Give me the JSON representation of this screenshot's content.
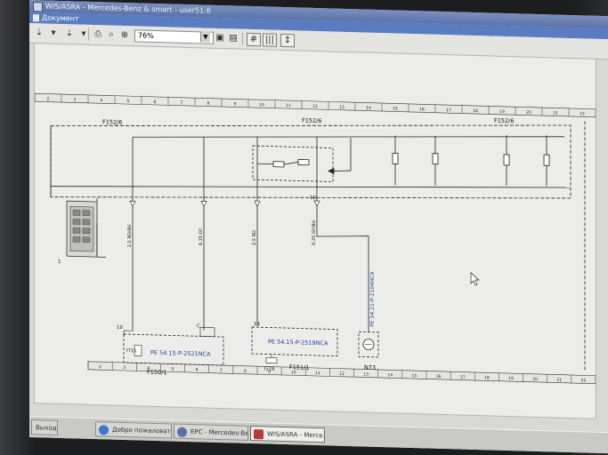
{
  "window": {
    "title": "WIS/ASRA - Mercedes-Benz & smart - user51:6",
    "menu_label": "Документ"
  },
  "toolbar": {
    "zoom_value": "76%",
    "icons": [
      "arrow-down-icon",
      "arrow-down-icon",
      "arrow-down-icon",
      "print-icon",
      "zoom-in-icon",
      "zoom-fit-icon",
      "camera-icon",
      "image-icon",
      "grid-icon",
      "columns-icon",
      "navigate-icon"
    ]
  },
  "diagram": {
    "ruler_numbers": [
      "2",
      "3",
      "4",
      "5",
      "6",
      "7",
      "8",
      "9",
      "10",
      "11",
      "12",
      "13",
      "14",
      "15",
      "16",
      "17",
      "18",
      "19",
      "20",
      "21",
      "22"
    ],
    "labels": {
      "f152_left": "F152/6",
      "f152_mid": "F152/6",
      "f152_right": "F152/6",
      "wire1": "2.5 RD/BU",
      "wire2": "0.35 GY",
      "wire3": "2.5 RD",
      "wire4": "0.35 GY/BU",
      "wire5": "PE 54.21-P-2104NCA",
      "ref1": "PE 54.15-P-2521NCA",
      "ref2": "PE 54.15-P-2519NCA",
      "f150": "F150/1",
      "f151": "F151/1",
      "g19": "G19",
      "f715": "f715",
      "n73": "N73",
      "pin10a": "10",
      "pin_c": "C",
      "pin13": "13",
      "pin10b": "10",
      "pin1": "1"
    }
  },
  "taskbar": {
    "exit": "Выход",
    "items": [
      {
        "label": "Добро пожаловать - ...",
        "color": "#3a78c8"
      },
      {
        "label": "EPC - Mercedes-Benz ...",
        "color": "#5a6fa8"
      },
      {
        "label": "WIS/ASRA - Merce...",
        "color": "#b83a3a"
      }
    ]
  }
}
